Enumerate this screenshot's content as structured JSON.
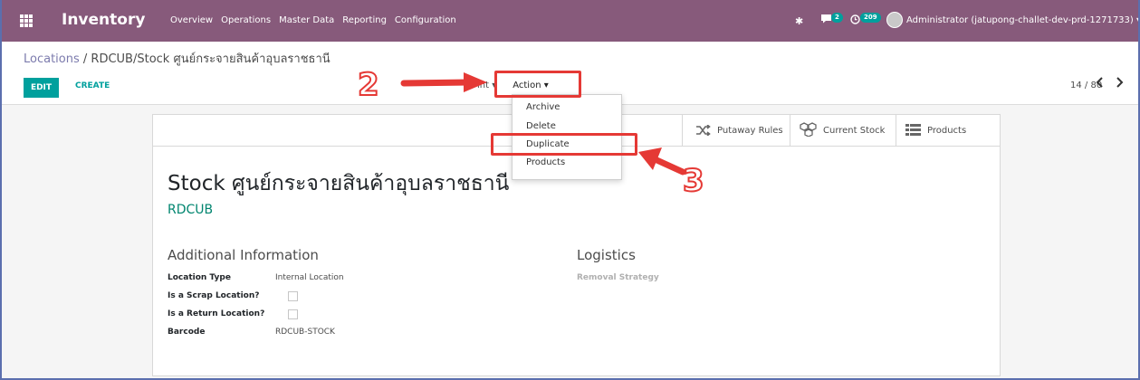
{
  "navbar": {
    "app_title": "Inventory",
    "menu": [
      "Overview",
      "Operations",
      "Master Data",
      "Reporting",
      "Configuration"
    ],
    "chat_badge": "2",
    "activity_badge": "209",
    "user": "Administrator (jatupong-challet-dev-prd-1271733)",
    "user_caret": "▾",
    "bg_color": "#875a7b"
  },
  "breadcrumb": {
    "parent": "Locations",
    "separator": " / ",
    "current": "RDCUB/Stock ศูนย์กระจายสินค้าอุบลราชธานี"
  },
  "controls": {
    "edit": "EDIT",
    "create": "CREATE",
    "print_partial": "int",
    "print_caret": "▾",
    "action": "Action",
    "action_caret": "▾",
    "pager": "14 / 80",
    "prev": "‹",
    "next": "›"
  },
  "action_menu": [
    "Archive",
    "Delete",
    "Duplicate",
    "Products"
  ],
  "smart_buttons": {
    "putaway": "Putaway Rules",
    "current_stock": "Current Stock",
    "products": "Products"
  },
  "record": {
    "title": "Stock ศูนย์กระจายสินค้าอุบลราชธานี",
    "subtitle": "RDCUB"
  },
  "sections": {
    "additional": "Additional Information",
    "logistics": "Logistics"
  },
  "fields": {
    "location_type_label": "Location Type",
    "location_type_value": "Internal Location",
    "scrap_label": "Is a Scrap Location?",
    "return_label": "Is a Return Location?",
    "barcode_label": "Barcode",
    "barcode_value": "RDCUB-STOCK",
    "removal_strategy_label": "Removal Strategy"
  },
  "annotations": {
    "step2": "2",
    "step3": "3",
    "color": "#e53935"
  },
  "accent_color": "#00a09d"
}
